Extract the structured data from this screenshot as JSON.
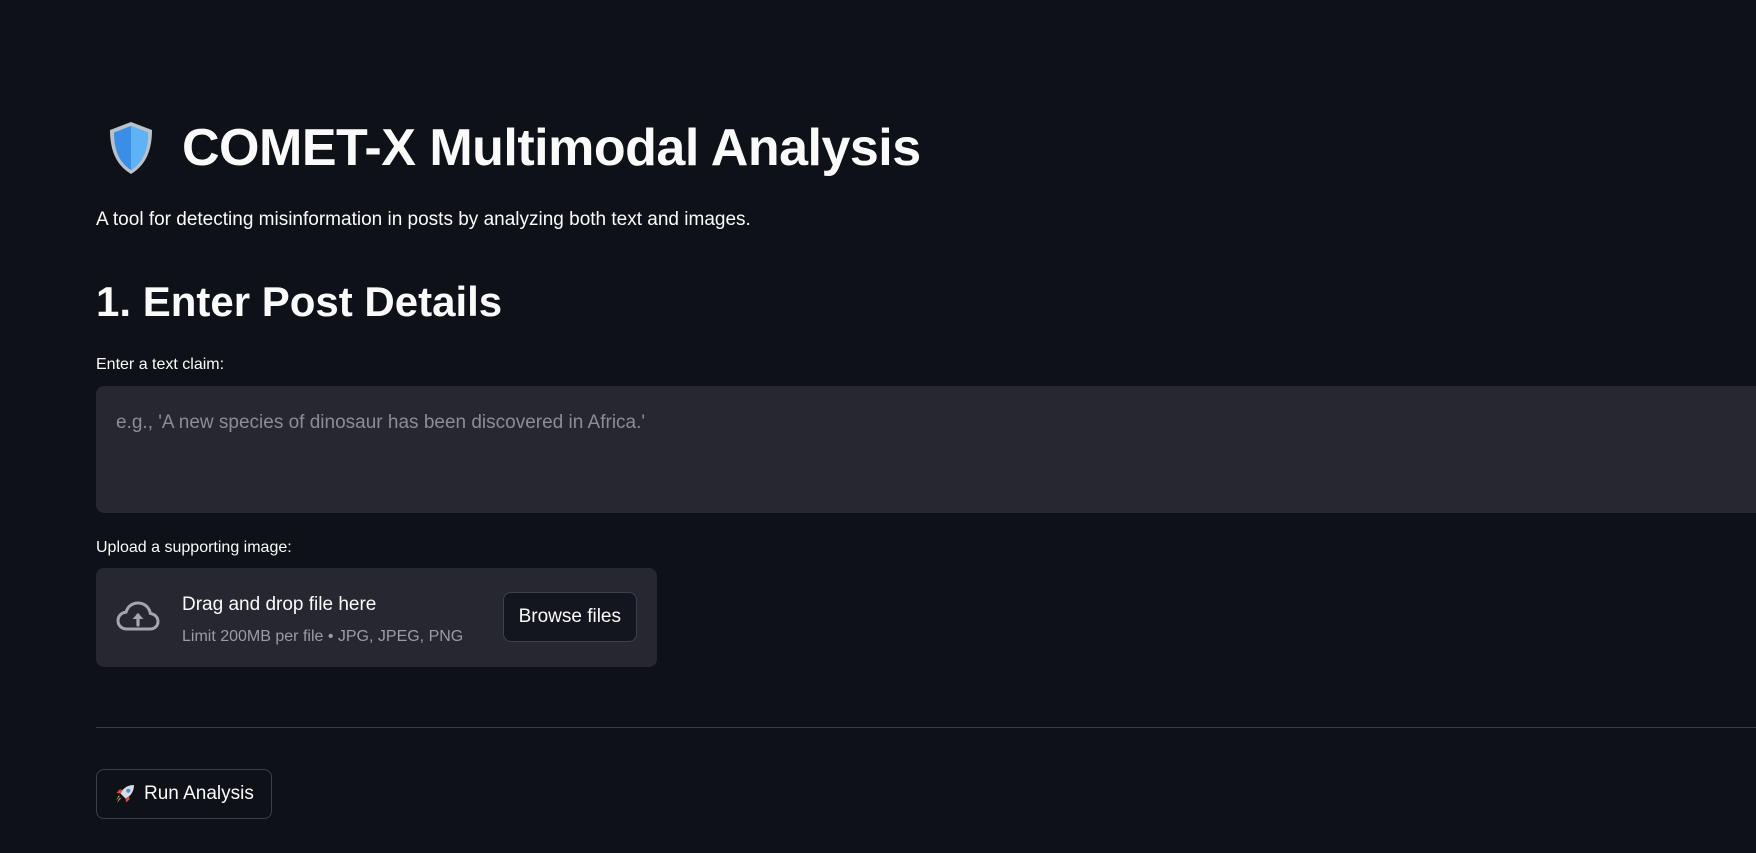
{
  "header": {
    "title_icon": "shield-icon",
    "title": "COMET-X Multimodal Analysis",
    "subtitle": "A tool for detecting misinformation in posts by analyzing both text and images."
  },
  "section": {
    "heading": "1. Enter Post Details"
  },
  "claim": {
    "label": "Enter a text claim:",
    "value": "",
    "placeholder": "e.g., 'A new species of dinosaur has been discovered in Africa.'"
  },
  "image_upload": {
    "label": "Upload a supporting image:",
    "icon": "cloud-upload-icon",
    "drop_text": "Drag and drop file here",
    "limit_text": "Limit 200MB per file • JPG, JPEG, PNG",
    "browse_label": "Browse files"
  },
  "actions": {
    "run_icon": "rocket-icon",
    "run_label": "Run Analysis"
  },
  "colors": {
    "background": "#0e1117",
    "surface": "#262730",
    "text": "#fafafa",
    "muted_text": "#9a9ca5",
    "border": "#3d404a"
  }
}
